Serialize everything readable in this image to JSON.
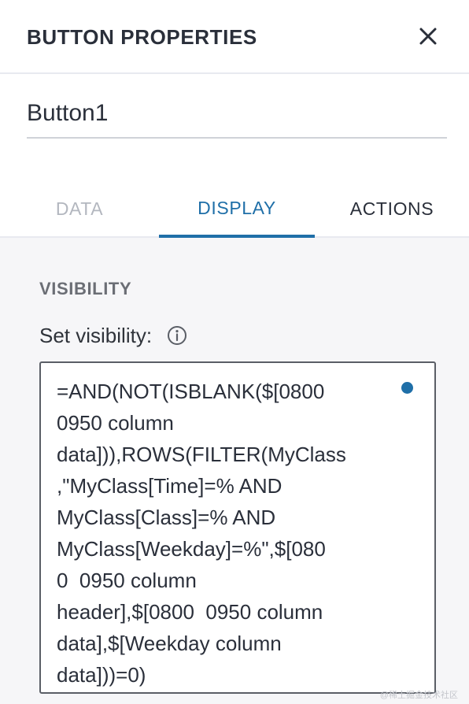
{
  "header": {
    "title": "BUTTON PROPERTIES",
    "close_icon": "close-icon"
  },
  "name_field": {
    "value": "Button1"
  },
  "tabs": [
    {
      "label": "DATA",
      "state": "disabled"
    },
    {
      "label": "DISPLAY",
      "state": "active"
    },
    {
      "label": "ACTIONS",
      "state": "inactive"
    }
  ],
  "visibility": {
    "heading": "VISIBILITY",
    "label": "Set visibility:",
    "info_icon": "info-icon",
    "formula_lines": "=AND(NOT(ISBLANK($[0800\n0950 column\ndata])),ROWS(FILTER(MyClass\n,\"MyClass[Time]=% AND\nMyClass[Class]=% AND\nMyClass[Weekday]=%\",$[080\n0  0950 column\nheader],$[0800  0950 column\ndata],$[Weekday column\ndata]))=0)"
  },
  "watermark": "@稀土掘金技术社区",
  "colors": {
    "accent": "#1f6fa8",
    "disabled_tab": "#b3b7bf",
    "background": "#f6f6f8"
  }
}
